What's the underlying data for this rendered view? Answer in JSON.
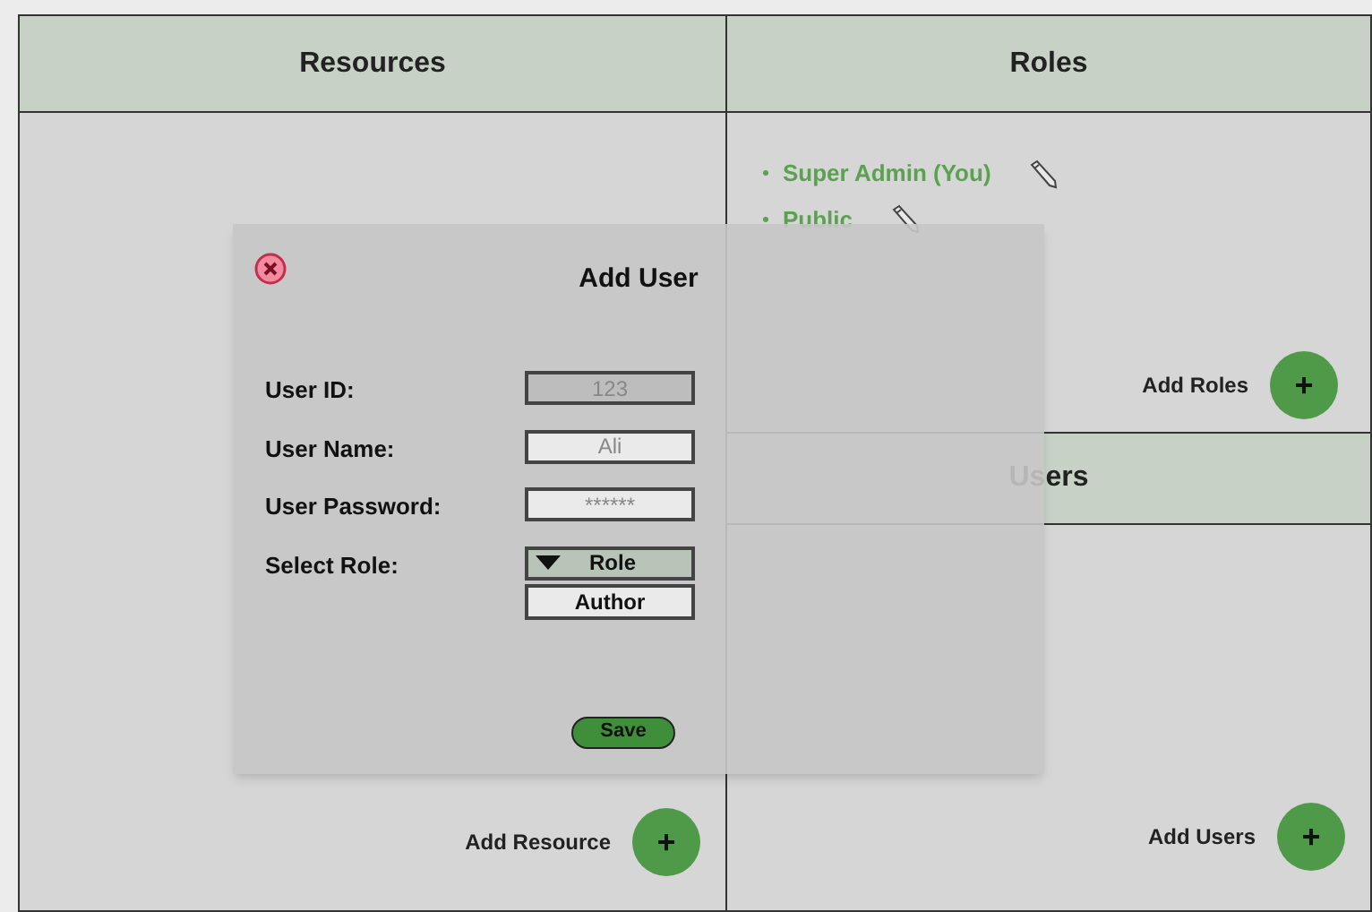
{
  "resources": {
    "title": "Resources",
    "add_label": "Add Resource",
    "add_button": "+"
  },
  "roles": {
    "title": "Roles",
    "items": [
      {
        "name": "Super Admin (You)"
      },
      {
        "name": "Public"
      }
    ],
    "add_label": "Add Roles",
    "add_button": "+"
  },
  "users": {
    "title": "Users",
    "add_label": "Add Users",
    "add_button": "+"
  },
  "dialog": {
    "title": "Add User",
    "fields": [
      {
        "kind": "text",
        "label": "User ID:",
        "value": "123",
        "disabled": true
      },
      {
        "kind": "text",
        "label": "User Name:",
        "value": "Ali",
        "disabled": false
      },
      {
        "kind": "text",
        "label": "User Password:",
        "value": "******",
        "disabled": false
      },
      {
        "kind": "select",
        "label": "Select Role:",
        "value": "Role",
        "options": [
          "Author"
        ]
      }
    ],
    "save": "Save"
  }
}
